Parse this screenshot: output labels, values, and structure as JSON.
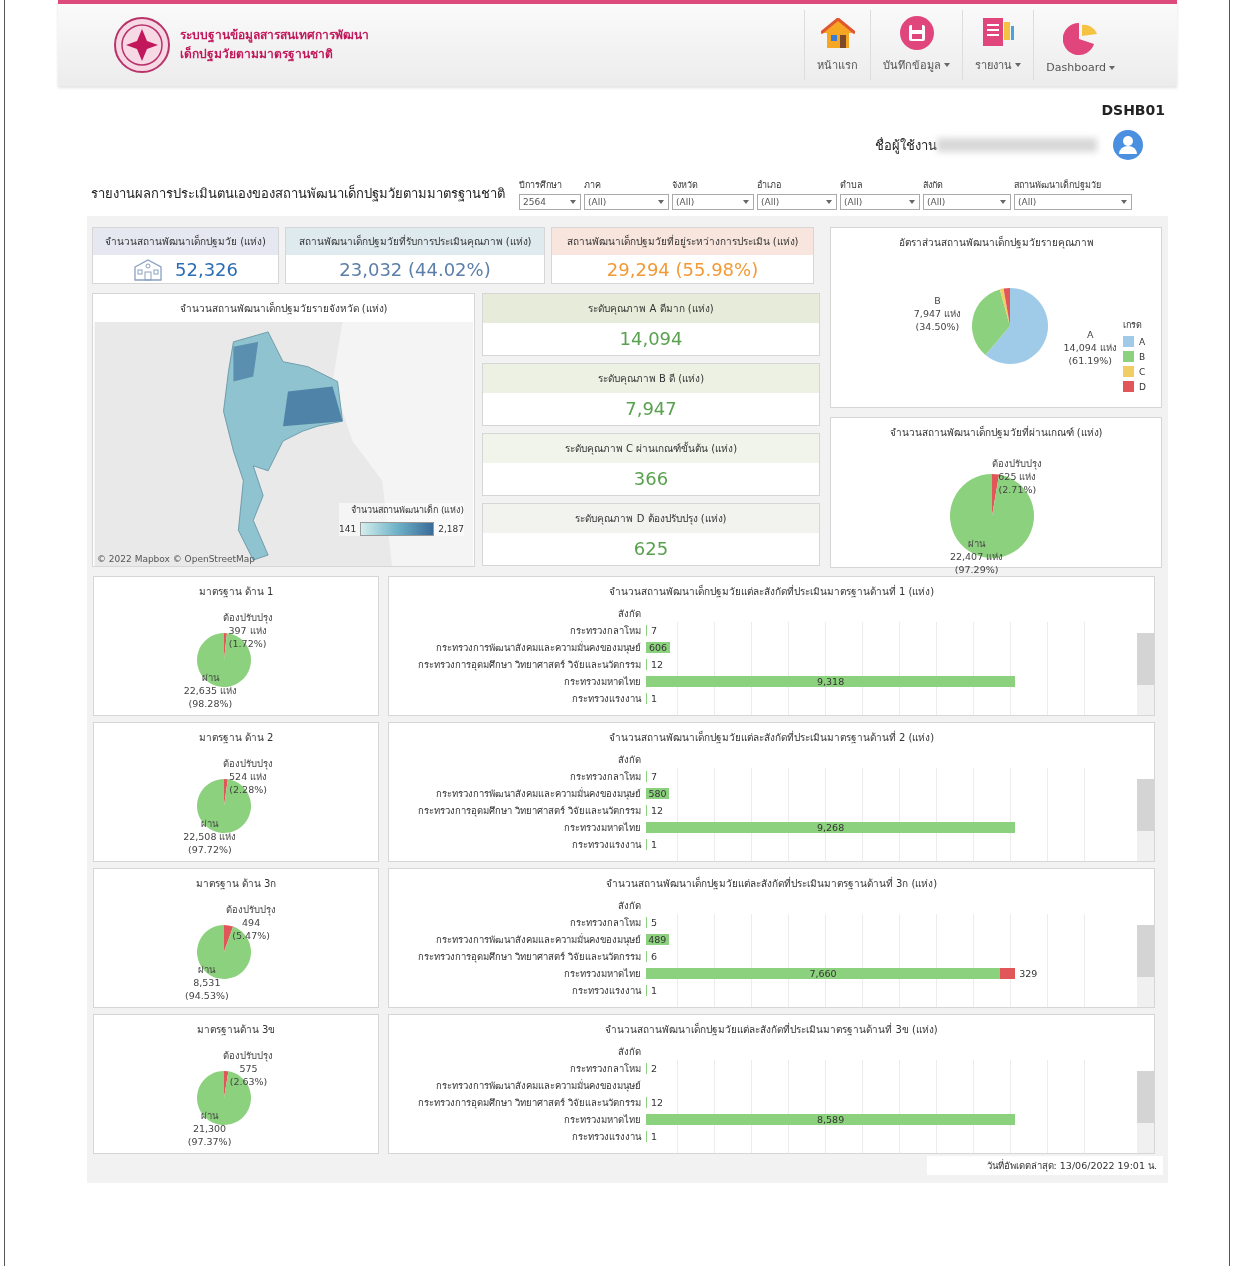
{
  "header": {
    "title_lines": [
      "ระบบฐานข้อมูลสารสนเทศการพัฒนา",
      "เด็กปฐมวัยตามมาตรฐานชาติ"
    ],
    "nav": [
      {
        "label": "หน้าแรก",
        "kind": "home",
        "dropdown": false
      },
      {
        "label": "บันทึกข้อมูล",
        "kind": "save",
        "dropdown": true
      },
      {
        "label": "รายงาน",
        "kind": "report",
        "dropdown": true
      },
      {
        "label": "Dashboard",
        "kind": "dashboard",
        "dropdown": true
      }
    ]
  },
  "page_code": "DSHB01",
  "user": {
    "label": "ชื่อผู้ใช้งาน"
  },
  "report": {
    "title": "รายงานผลการประเมินตนเองของสถานพัฒนาเด็กปฐมวัยตามมาตรฐานชาติ",
    "filters": [
      {
        "label": "ปีการศึกษา",
        "value": "2564"
      },
      {
        "label": "ภาค",
        "value": "(All)"
      },
      {
        "label": "จังหวัด",
        "value": "(All)"
      },
      {
        "label": "อำเภอ",
        "value": "(All)"
      },
      {
        "label": "ตำบล",
        "value": "(All)"
      },
      {
        "label": "สังกัด",
        "value": "(All)"
      },
      {
        "label": "สถานพัฒนาเด็กปฐมวัย",
        "value": "(All)"
      }
    ]
  },
  "kpis": [
    {
      "kind": "total",
      "title": "จำนวนสถานพัฒนาเด็กปฐมวัย (แห่ง)",
      "value": "52,326"
    },
    {
      "kind": "assessed",
      "title": "สถานพัฒนาเด็กปฐมวัยที่รับการประเมินคุณภาพ (แห่ง)",
      "value": "23,032 (44.02%)"
    },
    {
      "kind": "pending",
      "title": "สถานพัฒนาเด็กปฐมวัยที่อยู่ระหว่างการประเมิน (แห่ง)",
      "value": "29,294 (55.98%)"
    }
  ],
  "map": {
    "title": "จำนวนสถานพัฒนาเด็กปฐมวัยรายจังหวัด (แห่ง)",
    "legend": {
      "title": "จำนวนสถานพัฒนาเด็ก (แห่ง)",
      "min": "141",
      "max": "2,187"
    },
    "attribution": "© 2022 Mapbox © OpenStreetMap"
  },
  "quality_levels": [
    {
      "title": "ระดับคุณภาพ A ดีมาก (แห่ง)",
      "value": "14,094"
    },
    {
      "title": "ระดับคุณภาพ B ดี (แห่ง)",
      "value": "7,947"
    },
    {
      "title": "ระดับคุณภาพ C ผ่านเกณฑ์ขั้นต้น (แห่ง)",
      "value": "366"
    },
    {
      "title": "ระดับคุณภาพ D ต้องปรับปรุง (แห่ง)",
      "value": "625"
    }
  ],
  "quality_pie": {
    "chart_data": {
      "type": "pie",
      "title": "อัตราส่วนสถานพัฒนาเด็กปฐมวัยรายคุณภาพ",
      "legend": {
        "title": "เกรด"
      },
      "categories": [
        "A",
        "B",
        "C",
        "D"
      ],
      "values": [
        61.19,
        34.5,
        1.59,
        2.72
      ],
      "colors": [
        "#a0cbe8",
        "#8cd17d",
        "#f1ce63",
        "#e15759"
      ],
      "value_labels": [
        [
          "14,094 แห่ง",
          "(61.19%)"
        ],
        [
          "7,947 แห่ง",
          "(34.50%)"
        ],
        null,
        null
      ]
    }
  },
  "pass_pie": {
    "chart_data": {
      "type": "pie",
      "title": "จำนวนสถานพัฒนาเด็กปฐมวัยที่ผ่านเกณฑ์ (แห่ง)",
      "categories": [
        "ต้องปรับปรุง",
        "ผ่าน"
      ],
      "values": [
        2.71,
        97.29
      ],
      "colors": [
        "#e15759",
        "#8cd17d"
      ],
      "value_labels": [
        [
          "625 แห่ง",
          "(2.71%)"
        ],
        [
          "22,407 แห่ง",
          "(97.29%)"
        ]
      ]
    }
  },
  "standards": [
    {
      "pie": {
        "chart_data": {
          "type": "pie",
          "title": "มาตรฐาน ด้าน 1",
          "categories": [
            "ต้องปรับปรุง",
            "ผ่าน"
          ],
          "values": [
            1.72,
            98.28
          ],
          "colors": [
            "#e15759",
            "#8cd17d"
          ],
          "value_labels": [
            [
              "397 แห่ง",
              "(1.72%)"
            ],
            [
              "22,635 แห่ง",
              "(98.28%)"
            ]
          ]
        }
      },
      "bars": {
        "chart_data": {
          "type": "bar",
          "orientation": "horizontal",
          "stacked": true,
          "title": "จำนวนสถานพัฒนาเด็กปฐมวัยแต่ละสังกัดที่ประเมินมาตรฐานด้านที่ 1 (แห่ง)",
          "ylabel": "สังกัด",
          "categories": [
            "กระทรวงกลาโหม",
            "กระทรวงการพัฒนาสังคมและความมั่นคงของมนุษย์",
            "กระทรวงการอุดมศึกษา วิทยาศาสตร์ วิจัยและนวัตกรรม",
            "กระทรวงมหาดไทย",
            "กระทรวงแรงงาน"
          ],
          "series": [
            {
              "color": "#8cd17d",
              "values": [
                7,
                606,
                12,
                9318,
                1
              ],
              "value_labels": [
                "7",
                "606",
                "12",
                "9,318",
                "1"
              ]
            }
          ]
        }
      }
    },
    {
      "pie": {
        "chart_data": {
          "type": "pie",
          "title": "มาตรฐาน ด้าน 2",
          "categories": [
            "ต้องปรับปรุง",
            "ผ่าน"
          ],
          "values": [
            2.28,
            97.72
          ],
          "colors": [
            "#e15759",
            "#8cd17d"
          ],
          "value_labels": [
            [
              "524 แห่ง",
              "(2.28%)"
            ],
            [
              "22,508 แห่ง",
              "(97.72%)"
            ]
          ]
        }
      },
      "bars": {
        "chart_data": {
          "type": "bar",
          "orientation": "horizontal",
          "stacked": true,
          "title": "จำนวนสถานพัฒนาเด็กปฐมวัยแต่ละสังกัดที่ประเมินมาตรฐานด้านที่ 2 (แห่ง)",
          "ylabel": "สังกัด",
          "categories": [
            "กระทรวงกลาโหม",
            "กระทรวงการพัฒนาสังคมและความมั่นคงของมนุษย์",
            "กระทรวงการอุดมศึกษา วิทยาศาสตร์ วิจัยและนวัตกรรม",
            "กระทรวงมหาดไทย",
            "กระทรวงแรงงาน"
          ],
          "series": [
            {
              "color": "#8cd17d",
              "values": [
                7,
                580,
                12,
                9268,
                1
              ],
              "value_labels": [
                "7",
                "580",
                "12",
                "9,268",
                "1"
              ]
            }
          ]
        }
      }
    },
    {
      "pie": {
        "chart_data": {
          "type": "pie",
          "title": "มาตรฐาน ด้าน 3ก",
          "categories": [
            "ต้องปรับปรุง",
            "ผ่าน"
          ],
          "values": [
            5.47,
            94.53
          ],
          "colors": [
            "#e15759",
            "#8cd17d"
          ],
          "value_labels": [
            [
              "494",
              "(5.47%)"
            ],
            [
              "8,531",
              "(94.53%)"
            ]
          ]
        }
      },
      "bars": {
        "chart_data": {
          "type": "bar",
          "orientation": "horizontal",
          "stacked": true,
          "title": "จำนวนสถานพัฒนาเด็กปฐมวัยแต่ละสังกัดที่ประเมินมาตรฐานด้านที่ 3ก (แห่ง)",
          "ylabel": "สังกัด",
          "categories": [
            "กระทรวงกลาโหม",
            "กระทรวงการพัฒนาสังคมและความมั่นคงของมนุษย์",
            "กระทรวงการอุดมศึกษา วิทยาศาสตร์ วิจัยและนวัตกรรม",
            "กระทรวงมหาดไทย",
            "กระทรวงแรงงาน"
          ],
          "series": [
            {
              "color": "#8cd17d",
              "values": [
                5,
                489,
                6,
                7660,
                1
              ],
              "value_labels": [
                "5",
                "489",
                "6",
                "7,660",
                "1"
              ]
            },
            {
              "color": "#e15759",
              "values": [
                null,
                null,
                null,
                329,
                null
              ],
              "value_labels": [
                null,
                null,
                null,
                "329",
                null
              ]
            }
          ]
        }
      }
    },
    {
      "pie": {
        "chart_data": {
          "type": "pie",
          "title": "มาตรฐานด้าน 3ข",
          "categories": [
            "ต้องปรับปรุง",
            "ผ่าน"
          ],
          "values": [
            2.63,
            97.37
          ],
          "colors": [
            "#e15759",
            "#8cd17d"
          ],
          "value_labels": [
            [
              "575",
              "(2.63%)"
            ],
            [
              "21,300",
              "(97.37%)"
            ]
          ]
        }
      },
      "bars": {
        "chart_data": {
          "type": "bar",
          "orientation": "horizontal",
          "stacked": true,
          "title": "จำนวนสถานพัฒนาเด็กปฐมวัยแต่ละสังกัดที่ประเมินมาตรฐานด้านที่ 3ข (แห่ง)",
          "ylabel": "สังกัด",
          "categories": [
            "กระทรวงกลาโหม",
            "กระทรวงการพัฒนาสังคมและความมั่นคงของมนุษย์",
            "กระทรวงการอุดมศึกษา วิทยาศาสตร์ วิจัยและนวัตกรรม",
            "กระทรวงมหาดไทย",
            "กระทรวงแรงงาน"
          ],
          "series": [
            {
              "color": "#8cd17d",
              "values": [
                2,
                null,
                12,
                8589,
                1
              ],
              "value_labels": [
                "2",
                null,
                "12",
                "8,589",
                "1"
              ]
            }
          ]
        }
      }
    }
  ],
  "updated": "วันที่อัพเดตล่าสุด: 13/06/2022 19:01 น."
}
